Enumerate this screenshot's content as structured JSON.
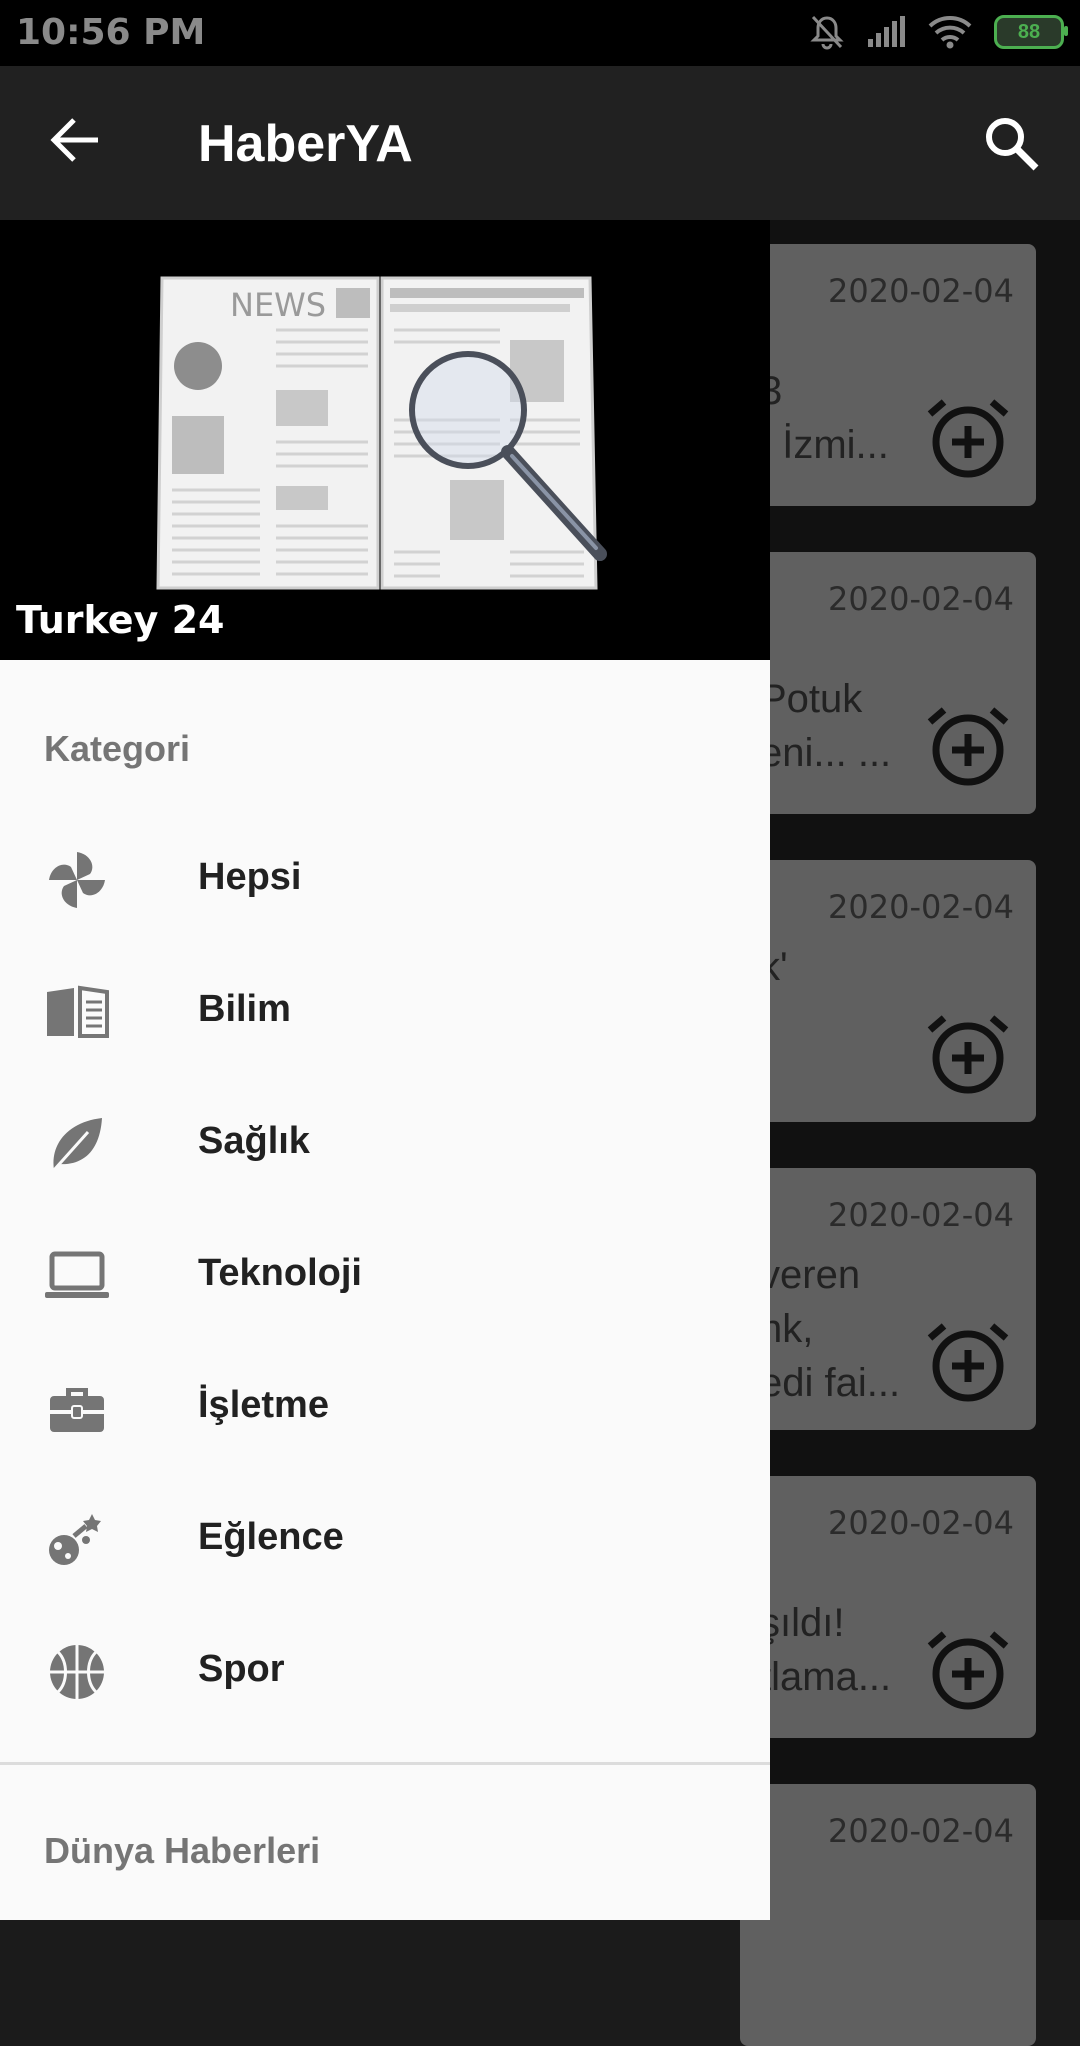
{
  "statusbar": {
    "time": "10:56 PM",
    "battery": "88"
  },
  "appbar": {
    "title": "HaberYA"
  },
  "drawer": {
    "image_text": "NEWS",
    "subtitle": "Turkey 24",
    "section_category": "Kategori",
    "items": [
      {
        "label": "Hepsi",
        "icon": "pinwheel-icon"
      },
      {
        "label": "Bilim",
        "icon": "book-icon"
      },
      {
        "label": "Sağlık",
        "icon": "leaf-icon"
      },
      {
        "label": "Teknoloji",
        "icon": "laptop-icon"
      },
      {
        "label": "İşletme",
        "icon": "briefcase-icon"
      },
      {
        "label": "Eğlence",
        "icon": "party-icon"
      },
      {
        "label": "Spor",
        "icon": "basketball-icon"
      }
    ],
    "section_world": "Dünya Haberleri"
  },
  "cards": [
    {
      "date": "2020-02-04",
      "snippet": "3\n! İzmi..."
    },
    {
      "date": "2020-02-04",
      "snippet": "Potuk\neni... ..."
    },
    {
      "date": "2020-02-04",
      "snippet": "k'"
    },
    {
      "date": "2020-02-04",
      "snippet": " veren\nnk,\nedi fai..."
    },
    {
      "date": "2020-02-04",
      "snippet": "şıldı!\ntlama..."
    },
    {
      "date": "2020-02-04",
      "snippet": ""
    }
  ]
}
